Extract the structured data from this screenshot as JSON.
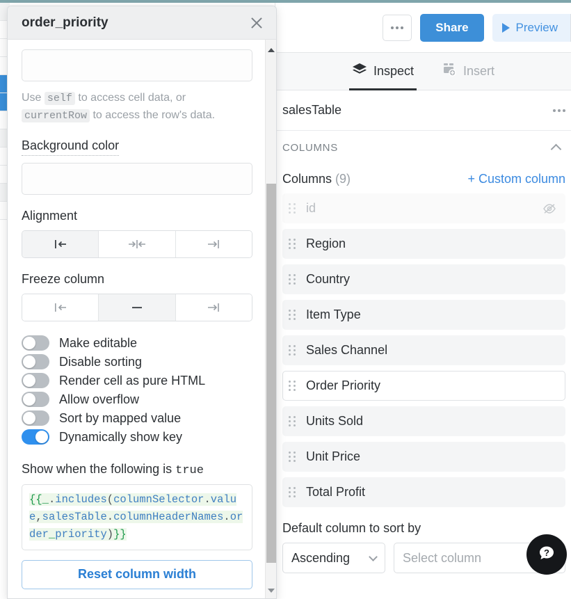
{
  "window": {
    "accent_teal": "#7fa5ab",
    "brand_blue": "#3d8fd8"
  },
  "toolbar": {
    "more_label": "",
    "share_label": "Share",
    "preview_label": "Preview"
  },
  "tabs": [
    {
      "label": "Inspect",
      "icon": "layers-icon",
      "active": true
    },
    {
      "label": "Insert",
      "icon": "add-component-icon",
      "active": false
    }
  ],
  "component": {
    "title": "salesTable"
  },
  "columns_section": {
    "section_label": "COLUMNS",
    "columns_label": "Columns",
    "columns_count": "(9)",
    "custom_column_label": "+ Custom column",
    "items": [
      {
        "label": "id",
        "hidden": true,
        "selected": false
      },
      {
        "label": "Region",
        "hidden": false,
        "selected": false
      },
      {
        "label": "Country",
        "hidden": false,
        "selected": false
      },
      {
        "label": "Item Type",
        "hidden": false,
        "selected": false
      },
      {
        "label": "Sales Channel",
        "hidden": false,
        "selected": false
      },
      {
        "label": "Order Priority",
        "hidden": false,
        "selected": true
      },
      {
        "label": "Units Sold",
        "hidden": false,
        "selected": false
      },
      {
        "label": "Unit Price",
        "hidden": false,
        "selected": false
      },
      {
        "label": "Total Profit",
        "hidden": false,
        "selected": false
      }
    ],
    "sort_label": "Default column to sort by",
    "sort_direction": "Ascending",
    "sort_column_placeholder": "Select column"
  },
  "help": {
    "icon": "question-bubble-icon"
  },
  "dialog": {
    "title": "order_priority",
    "close_icon": "close-icon",
    "value_input": "",
    "helper_prefix": "Use",
    "helper_code_1": "self",
    "helper_mid": "to access cell data, or",
    "helper_code_2": "currentRow",
    "helper_suffix": "to access the row's data.",
    "background_color_label": "Background color",
    "background_color_value": "",
    "alignment_label": "Alignment",
    "alignment_options": [
      {
        "name": "align-left",
        "selected": true
      },
      {
        "name": "align-center",
        "selected": false
      },
      {
        "name": "align-right",
        "selected": false
      }
    ],
    "freeze_label": "Freeze column",
    "freeze_options": [
      {
        "name": "freeze-left",
        "selected": false
      },
      {
        "name": "freeze-none",
        "selected": true
      },
      {
        "name": "freeze-right",
        "selected": false
      }
    ],
    "toggles": [
      {
        "label": "Make editable",
        "on": false
      },
      {
        "label": "Disable sorting",
        "on": false
      },
      {
        "label": "Render cell as pure HTML",
        "on": false
      },
      {
        "label": "Allow overflow",
        "on": false
      },
      {
        "label": "Sort by mapped value",
        "on": false
      },
      {
        "label": "Dynamically show key",
        "on": true
      }
    ],
    "show_when_prefix": "Show when the following is",
    "show_when_value": "true",
    "expression": "{{_.includes(columnSelector.value,salesTable.columnHeaderNames.order_priority)}}",
    "reset_label": "Reset column width"
  }
}
